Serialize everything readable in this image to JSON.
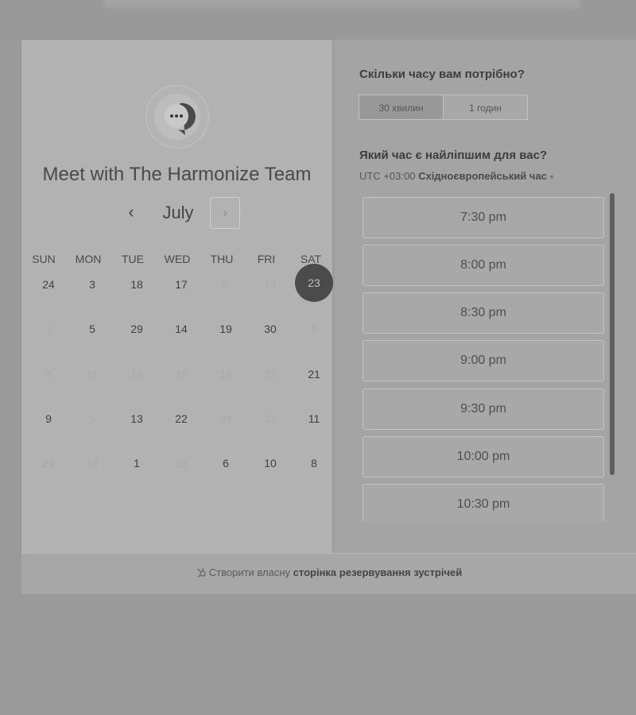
{
  "meeting": {
    "title": "Meet with The Harmonize Team"
  },
  "calendar": {
    "month": "July",
    "prev_label": "‹",
    "next_label": "›",
    "weekdays": [
      "SUN",
      "MON",
      "TUE",
      "WED",
      "THU",
      "FRI",
      "SAT"
    ],
    "weeks": [
      [
        {
          "d": "24",
          "s": "avail"
        },
        {
          "d": "3",
          "s": "avail"
        },
        {
          "d": "18",
          "s": "avail"
        },
        {
          "d": "17",
          "s": "avail"
        },
        {
          "d": "5",
          "s": "dim"
        },
        {
          "d": "14",
          "s": "dim"
        },
        {
          "d": "23",
          "s": "selected"
        }
      ],
      [
        {
          "d": "3",
          "s": "dim"
        },
        {
          "d": "5",
          "s": "avail"
        },
        {
          "d": "29",
          "s": "avail"
        },
        {
          "d": "14",
          "s": "avail"
        },
        {
          "d": "19",
          "s": "avail"
        },
        {
          "d": "30",
          "s": "avail"
        },
        {
          "d": "9",
          "s": "dim"
        }
      ],
      [
        {
          "d": "4",
          "s": "dim"
        },
        {
          "d": "11",
          "s": "dim"
        },
        {
          "d": "19",
          "s": "dim"
        },
        {
          "d": "19",
          "s": "dim"
        },
        {
          "d": "16",
          "s": "dim"
        },
        {
          "d": "27",
          "s": "dim"
        },
        {
          "d": "21",
          "s": "avail"
        }
      ],
      [
        {
          "d": "9",
          "s": "avail"
        },
        {
          "d": "5",
          "s": "dim"
        },
        {
          "d": "13",
          "s": "avail"
        },
        {
          "d": "22",
          "s": "avail"
        },
        {
          "d": "24",
          "s": "dim"
        },
        {
          "d": "17",
          "s": "dim"
        },
        {
          "d": "11",
          "s": "avail"
        }
      ],
      [
        {
          "d": "24",
          "s": "dim"
        },
        {
          "d": "18",
          "s": "dim"
        },
        {
          "d": "1",
          "s": "avail"
        },
        {
          "d": "28",
          "s": "dim"
        },
        {
          "d": "6",
          "s": "avail"
        },
        {
          "d": "10",
          "s": "avail"
        },
        {
          "d": "8",
          "s": "avail"
        }
      ]
    ]
  },
  "booking": {
    "duration_question": "Скільки часу вам потрібно?",
    "durations": [
      {
        "label": "30 хвилин",
        "active": true
      },
      {
        "label": "1 годин",
        "active": false
      }
    ],
    "time_question": "Який час є найліпшим для вас?",
    "timezone_offset": "UTC +03:00",
    "timezone_name": "Східноєвропейський час",
    "timezone_caret": "▾",
    "slots": [
      "7:30 pm",
      "8:00 pm",
      "8:30 pm",
      "9:00 pm",
      "9:30 pm",
      "10:00 pm",
      "10:30 pm"
    ]
  },
  "footer": {
    "prefix": "Створити власну",
    "link": "сторінка резервування зустрічей"
  },
  "colors": {
    "selected_day_bg": "#4b4b4b",
    "scrollbar": "#606060"
  },
  "icons": {
    "avatar": "chat-bubble-icon",
    "footer": "hubspot-sprocket-icon"
  }
}
